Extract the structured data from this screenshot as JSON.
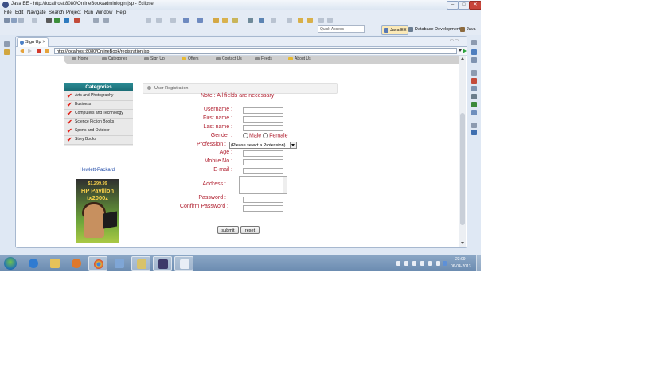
{
  "window": {
    "title": "Java EE - http://localhost:8080/OnlineBook/adminlogin.jsp - Eclipse",
    "min": "–",
    "max": "□",
    "close": "✕"
  },
  "menu": [
    "File",
    "Edit",
    "Navigate",
    "Search",
    "Project",
    "Run",
    "Window",
    "Help"
  ],
  "quick_access": {
    "placeholder": "Quick Access"
  },
  "perspectives": {
    "java_ee": "Java EE",
    "database": "Database Development",
    "java": "Java"
  },
  "editor": {
    "tab_label": "Sign Up",
    "tab_close": "✕",
    "tab_controls": "▭ ▭",
    "url": "http://localhost:8080/OnlineBook/registration.jsp"
  },
  "site": {
    "nav": [
      "Home",
      "Categories",
      "Sign Up",
      "Offers",
      "Contact Us",
      "Feeds",
      "About Us"
    ],
    "categories_title": "Categories",
    "categories": [
      "Arts and Photography",
      "Business",
      "Computers and Technology",
      "Science Fiction Books",
      "Sports and Outdoor",
      "Story Books"
    ],
    "check": "✔",
    "ad": {
      "brand": "Hewlett-Packard",
      "price": "$1,299.99",
      "model_line1": "HP Pavilion",
      "model_line2": "tx2000z"
    },
    "panel_title": "User Registration",
    "note": "Note : All fields are necessary",
    "form": {
      "username": "Username :",
      "first_name": "First name :",
      "last_name": "Last name :",
      "gender": "Gender :",
      "male": "Male",
      "female": "Female",
      "profession": "Profession :",
      "profession_value": "(Please select a Profession)",
      "age": "Age :",
      "mobile": "Mobile No :",
      "email": "E-mail :",
      "address": "Address :",
      "password": "Password :",
      "confirm_password": "Confirm Password :",
      "submit": "submit",
      "reset": "reset"
    }
  },
  "taskbar": {
    "time": "23:09",
    "date": "06-04-2013"
  },
  "colors": {
    "accent_red": "#b02030",
    "category_header": "#1f7a84",
    "taskbar": "#7b97ba",
    "check_red": "#e2231a"
  }
}
